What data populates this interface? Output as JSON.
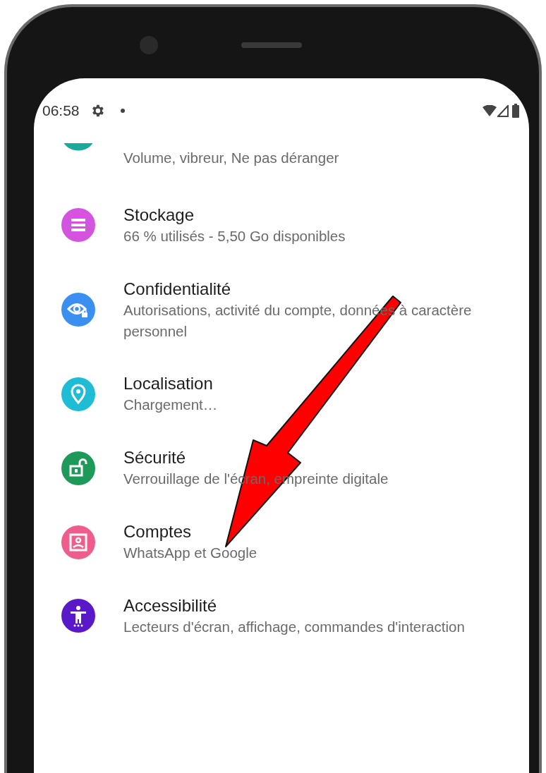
{
  "status_bar": {
    "time": "06:58"
  },
  "settings": [
    {
      "subtitle": "Volume, vibreur, Ne pas déranger",
      "color": "#1aa99a"
    },
    {
      "title": "Stockage",
      "subtitle": "66 % utilisés - 5,50 Go disponibles",
      "color": "#d454e0"
    },
    {
      "title": "Confidentialité",
      "subtitle": "Autorisations, activité du compte, données à caractère personnel",
      "color": "#3b8ff0"
    },
    {
      "title": "Localisation",
      "subtitle": "Chargement…",
      "color": "#1fbcd6"
    },
    {
      "title": "Sécurité",
      "subtitle": "Verrouillage de l'écran, empreinte digitale",
      "color": "#1d9a5a"
    },
    {
      "title": "Comptes",
      "subtitle": "WhatsApp et Google",
      "color": "#ee5d8c"
    },
    {
      "title": "Accessibilité",
      "subtitle": "Lecteurs d'écran, affichage, commandes d'interaction",
      "color": "#5a19c8"
    }
  ]
}
